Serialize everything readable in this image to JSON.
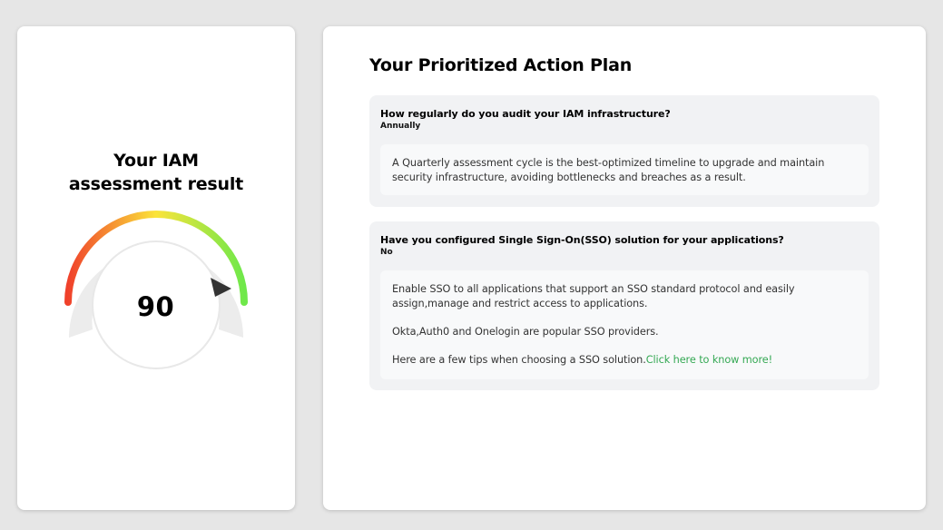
{
  "assessment": {
    "title_line1": "Your IAM",
    "title_line2": "assessment result",
    "score": "90",
    "score_value": 90,
    "score_max": 100
  },
  "plan": {
    "title": "Your Prioritized Action Plan",
    "items": [
      {
        "question": "How regularly do you audit your IAM infrastructure?",
        "answer": "Annually",
        "advice": [
          "A Quarterly assessment cycle is the best-optimized timeline to upgrade and maintain security infrastructure, avoiding bottlenecks and breaches as a result."
        ]
      },
      {
        "question": "Have you configured Single Sign-On(SSO) solution for your applications?",
        "answer": "No",
        "advice": [
          "Enable SSO to all applications that support an SSO standard protocol and easily assign,manage and restrict access to applications.",
          "Okta,Auth0 and Onelogin are popular SSO providers.",
          "Here are a few tips when choosing a SSO solution."
        ],
        "link_text": "Click here to know more!"
      }
    ]
  },
  "colors": {
    "gauge_start": "#f0412b",
    "gauge_mid": "#fbe43a",
    "gauge_end": "#6ee84a",
    "link": "#34a853"
  },
  "icons": {
    "needle": "needle-pointer-icon"
  }
}
